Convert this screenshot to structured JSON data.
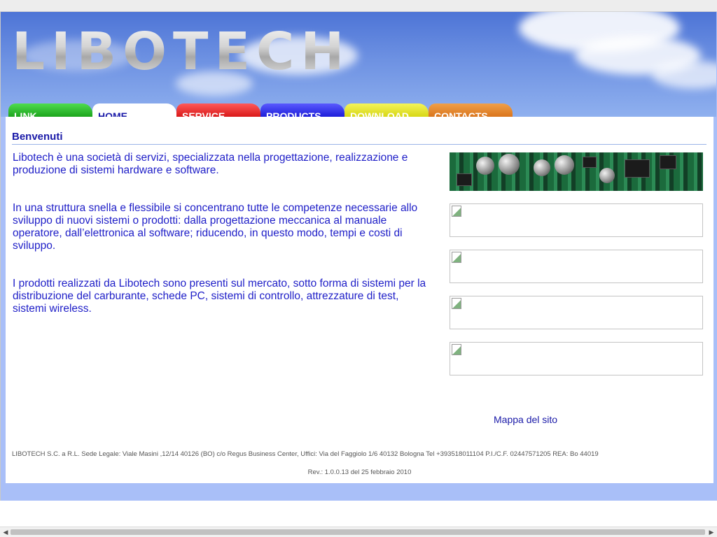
{
  "header": {
    "logo_text": "LIBOTECH"
  },
  "tabs": [
    {
      "label": "LINK"
    },
    {
      "label": "HOME"
    },
    {
      "label": "SERVICE"
    },
    {
      "label": "PRODUCTS"
    },
    {
      "label": "DOWNLOAD"
    },
    {
      "label": "CONTACTS"
    }
  ],
  "main": {
    "title": "Benvenuti",
    "paragraphs": [
      "Libotech è una società di servizi, specializzata nella progettazione, realizzazione e produzione di sistemi hardware e software.",
      "In una struttura snella e flessibile si concentrano tutte le competenze necessarie allo sviluppo di nuovi sistemi o prodotti: dalla progettazione meccanica al manuale operatore, dall’elettronica al software; riducendo, in questo modo, tempi e costi di sviluppo.",
      "I prodotti realizzati da Libotech sono presenti sul mercato, sotto forma di sistemi per la distribuzione del carburante, schede PC, sistemi di controllo, attrezzature di test, sistemi wireless."
    ]
  },
  "sitemap_link": "Mappa del sito",
  "footer": {
    "company_info": "LIBOTECH S.C. a R.L. Sede Legale: Viale Masini ,12/14 40126 (BO) c/o Regus Business Center, Uffici: Via del Faggiolo 1/6 40132 Bologna  Tel +393518011104 P.I./C.F. 02447571205 REA: Bo 44019",
    "revision": "Rev.: 1.0.0.13 del 25 febbraio 2010"
  },
  "colors": {
    "link_blue": "#1a1aa8",
    "text_blue": "#2020c8",
    "frame": "#a9bff8",
    "tab_link": "#1aa21a",
    "tab_service": "#d81616",
    "tab_products": "#1b1bd8",
    "tab_download": "#d6d612",
    "tab_contacts": "#d9731a"
  },
  "icons": {
    "broken_image": "broken-image-icon",
    "scroll_left": "chevron-left-icon",
    "scroll_right": "chevron-right-icon"
  }
}
